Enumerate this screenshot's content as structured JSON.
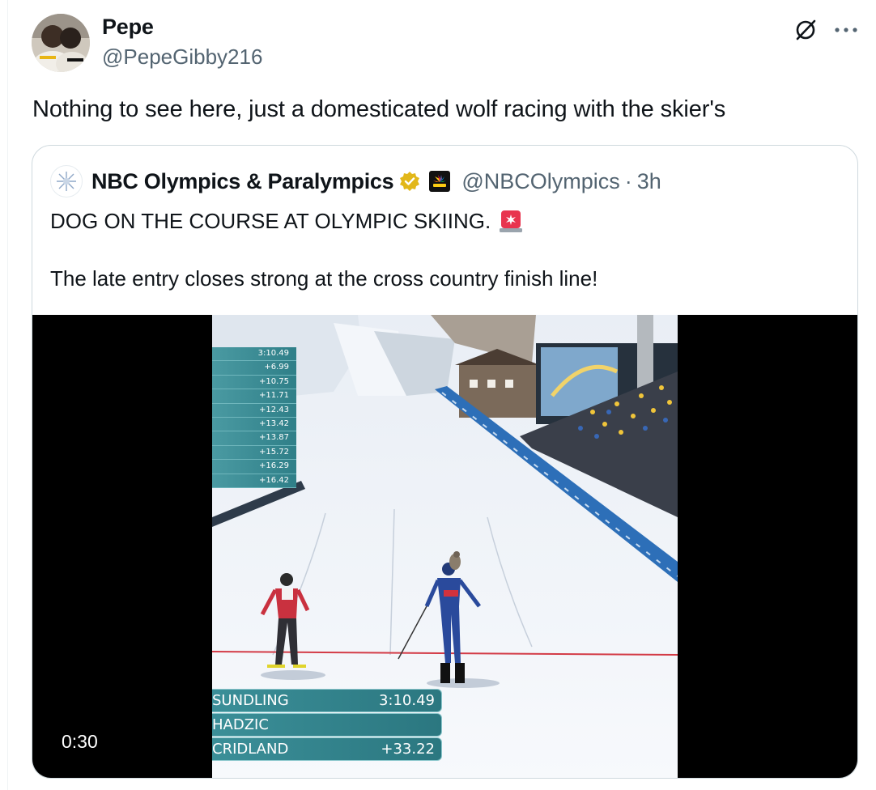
{
  "author": {
    "name": "Pepe",
    "handle": "@PepeGibby216"
  },
  "tweet": {
    "text": "Nothing to see here, just a domesticated wolf racing with the skier's"
  },
  "icons": {
    "grok": "grok-icon",
    "more": "more-icon",
    "verified": "verified-badge-icon",
    "affiliate": "nbc-sports-affiliate-icon",
    "siren": "police-light-emoji-icon"
  },
  "quoted": {
    "name": "NBC Olympics & Paralympics",
    "handle": "@NBCOlympics",
    "separator": "·",
    "time": "3h",
    "line1": "DOG ON THE COURSE AT OLYMPIC SKIING.",
    "line2": "The late entry closes strong at the cross country finish line!"
  },
  "video": {
    "timestamp": "0:30",
    "split_times": [
      "3:10.49",
      "+6.99",
      "+10.75",
      "+11.71",
      "+12.43",
      "+13.42",
      "+13.87",
      "+15.72",
      "+16.29",
      "+16.42"
    ],
    "results": [
      {
        "name": "SUNDLING",
        "time": "3:10.49"
      },
      {
        "name": "HADZIC",
        "time": ""
      },
      {
        "name": "CRIDLAND",
        "time": "+33.22"
      }
    ]
  },
  "colors": {
    "text_primary": "#0f1419",
    "text_secondary": "#536471",
    "border": "#cfd9de",
    "verified_gold": "#e2b719",
    "overlay_teal": "#2f7f88"
  }
}
